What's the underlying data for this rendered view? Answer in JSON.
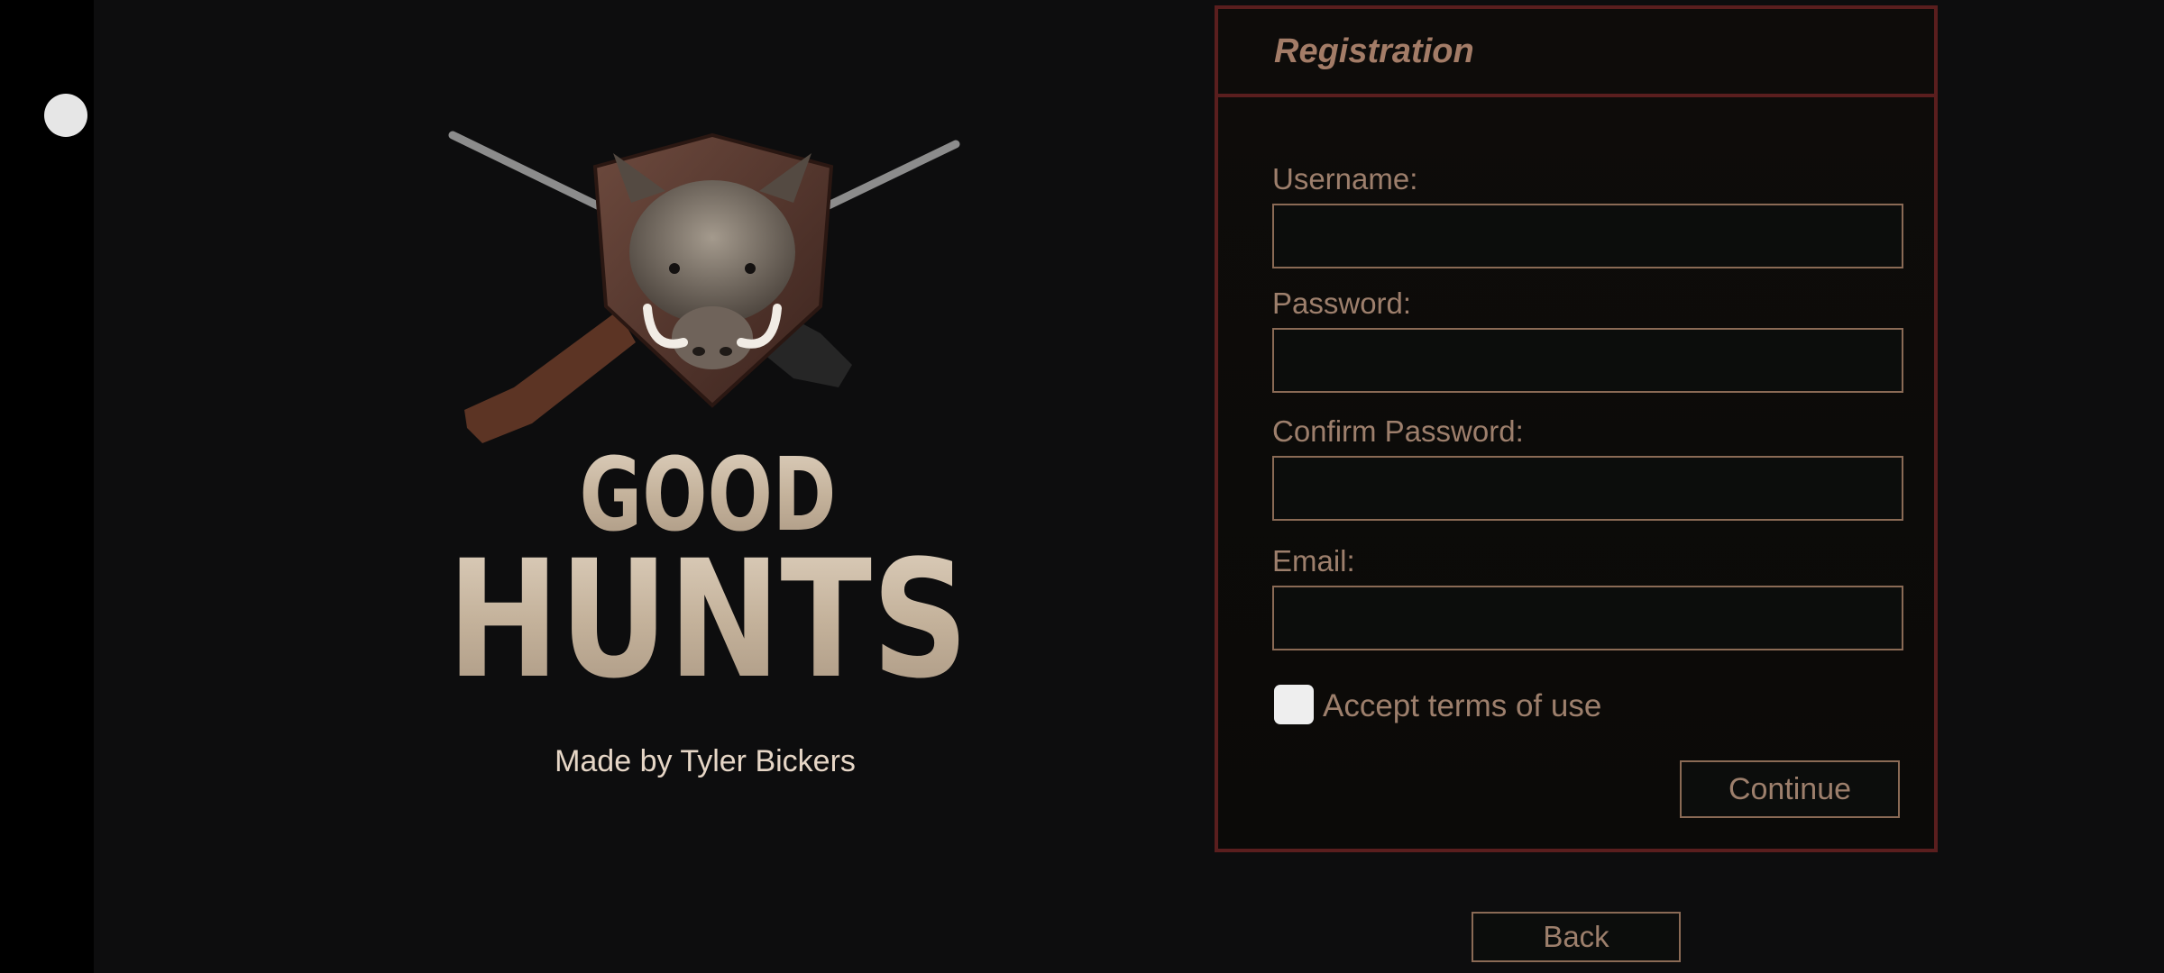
{
  "logo": {
    "line1": "GOOD",
    "line2": "HUNTS"
  },
  "credit": "Made by Tyler Bickers",
  "registration": {
    "title": "Registration",
    "fields": [
      {
        "label": "Username:",
        "value": ""
      },
      {
        "label": "Password:",
        "value": ""
      },
      {
        "label": "Confirm Password:",
        "value": ""
      },
      {
        "label": "Email:",
        "value": ""
      }
    ],
    "accept_terms_label": "Accept terms of use",
    "accept_terms_checked": false,
    "continue_label": "Continue"
  },
  "back_label": "Back",
  "colors": {
    "panel_border": "#5a1e1e",
    "text_tan": "#9d7f6c",
    "background": "#0d0d0e"
  }
}
